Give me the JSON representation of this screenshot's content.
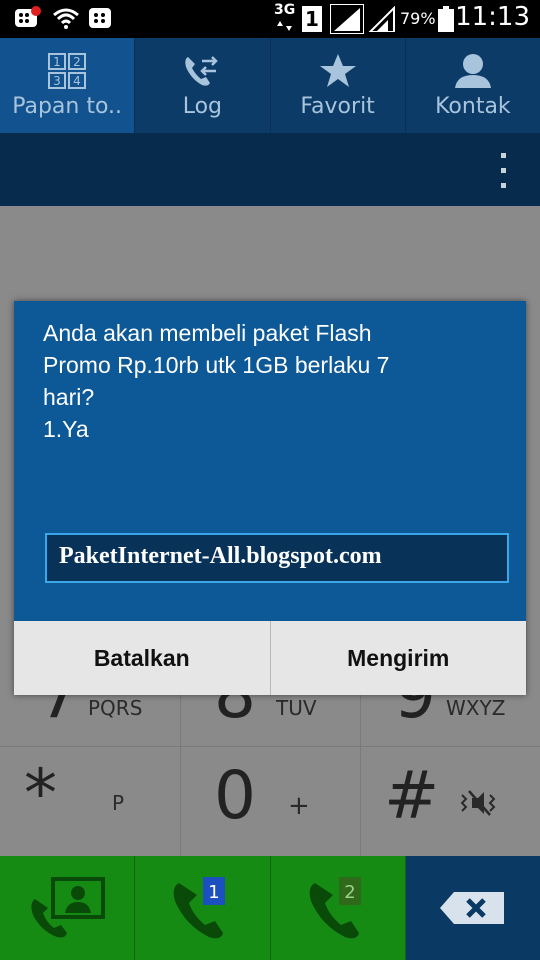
{
  "status_bar": {
    "network_type": "3G",
    "sim_slot": "1",
    "battery": "79%",
    "time": "11:13",
    "icons": [
      "bbm-notification-icon",
      "wifi-icon",
      "bbm-icon",
      "network-3g-icon",
      "sim1-icon",
      "signal-icon",
      "signal-icon",
      "battery-icon"
    ]
  },
  "tabs": [
    {
      "label": "Papan to..",
      "icon": "keypad-icon",
      "active": true
    },
    {
      "label": "Log",
      "icon": "call-log-icon",
      "active": false
    },
    {
      "label": "Favorit",
      "icon": "star-icon",
      "active": false
    },
    {
      "label": "Kontak",
      "icon": "contact-icon",
      "active": false
    }
  ],
  "keypad": {
    "row3": [
      {
        "digit": "7",
        "letters": "PQRS"
      },
      {
        "digit": "8",
        "letters": "TUV"
      },
      {
        "digit": "9",
        "letters": "WXYZ"
      }
    ],
    "row4": [
      {
        "digit": "*",
        "letters": "P"
      },
      {
        "digit": "0",
        "letters": "+"
      },
      {
        "digit": "#",
        "letters": ""
      }
    ]
  },
  "bottom_bar": {
    "sim1_label": "1",
    "sim2_label": "2",
    "buttons": [
      "video-call-icon",
      "call-sim1-icon",
      "call-sim2-icon",
      "backspace-icon"
    ]
  },
  "dialog": {
    "message": "Anda akan membeli paket Flash\nPromo Rp.10rb utk 1GB berlaku 7\nhari?\n1.Ya",
    "input_value": "PaketInternet-All.blogspot.com",
    "cancel_label": "Batalkan",
    "send_label": "Mengirim"
  },
  "colors": {
    "dialog_blue": "#0d5896",
    "call_green": "#168b14",
    "input_border": "#3aa7e8"
  }
}
